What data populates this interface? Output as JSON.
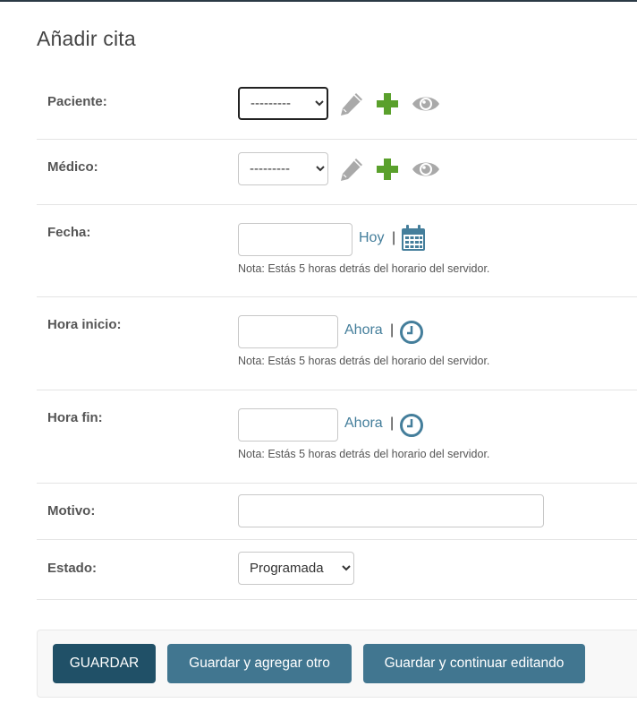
{
  "page": {
    "title": "Añadir cita"
  },
  "form": {
    "paciente": {
      "label": "Paciente:",
      "value": "---------"
    },
    "medico": {
      "label": "Médico:",
      "value": "---------"
    },
    "fecha": {
      "label": "Fecha:",
      "value": "",
      "shortcut": "Hoy",
      "separator": "|",
      "help": "Nota: Estás 5 horas detrás del horario del servidor."
    },
    "hora_inicio": {
      "label": "Hora inicio:",
      "value": "",
      "shortcut": "Ahora",
      "separator": "|",
      "help": "Nota: Estás 5 horas detrás del horario del servidor."
    },
    "hora_fin": {
      "label": "Hora fin:",
      "value": "",
      "shortcut": "Ahora",
      "separator": "|",
      "help": "Nota: Estás 5 horas detrás del horario del servidor."
    },
    "motivo": {
      "label": "Motivo:",
      "value": ""
    },
    "estado": {
      "label": "Estado:",
      "value": "Programada"
    }
  },
  "buttons": {
    "save": "GUARDAR",
    "save_add": "Guardar y agregar otro",
    "save_continue": "Guardar y continuar editando"
  },
  "colors": {
    "link": "#447e9b",
    "primary_button": "#205067",
    "secondary_button": "#417690",
    "add_icon": "#5aa02c",
    "muted_icon": "#a9a9a9"
  },
  "icons": [
    "pencil-icon",
    "plus-icon",
    "eye-icon",
    "calendar-icon",
    "clock-icon",
    "chevron-down-icon"
  ]
}
